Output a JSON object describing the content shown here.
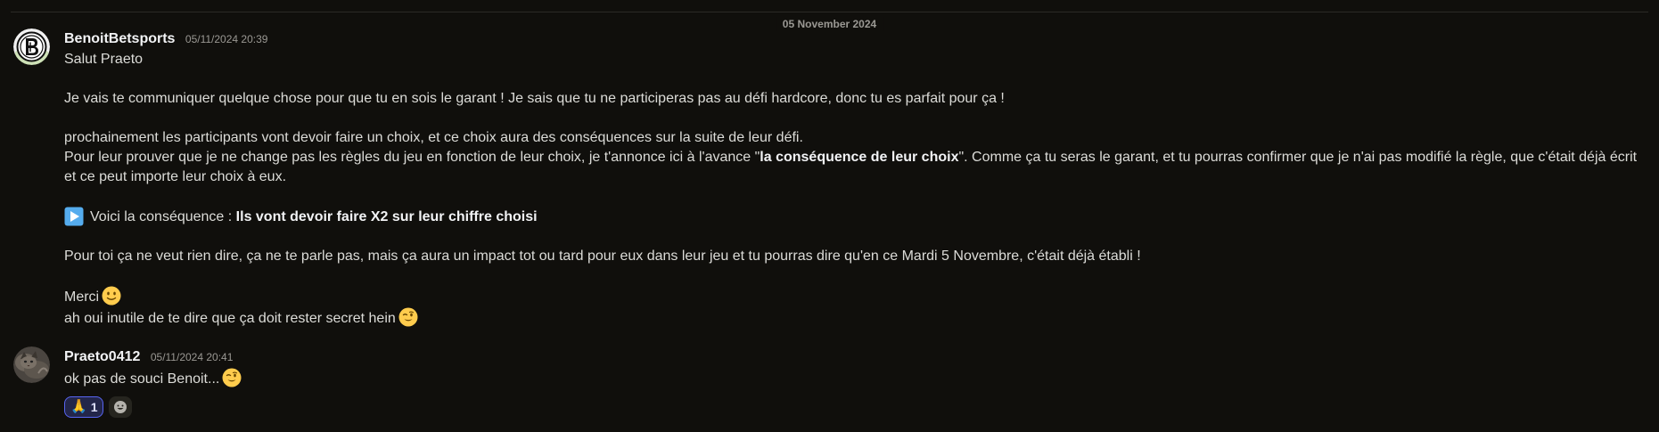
{
  "date_divider": "05 November 2024",
  "messages": [
    {
      "username": "BenoitBetsports",
      "timestamp": "05/11/2024 20:39",
      "avatar_icon": "benoitbetsports-logo-avatar",
      "lines": {
        "l1": "Salut Praeto",
        "l2": "Je vais te communiquer quelque chose pour que tu en sois le garant ! Je sais que tu ne participeras pas au défi hardcore, donc tu es parfait pour ça !",
        "l3": "prochainement les participants vont devoir faire un choix, et ce choix aura des conséquences sur la suite de leur défi.",
        "l4_a": "Pour leur prouver que je ne change pas les règles du jeu en fonction de leur choix, je t'annonce ici à l'avance \"",
        "l4_b": "la conséquence de leur choix",
        "l4_c": "\". Comme ça tu seras le garant, et tu pourras confirmer que je n'ai pas modifié la règle, que c'était déjà écrit et ce peut importe leur choix à eux.",
        "l5_a": "Voici la conséquence : ",
        "l5_b": "Ils vont devoir faire X2 sur leur chiffre choisi",
        "l6": "Pour toi ça ne veut rien dire, ça ne te parle pas, mais ça aura un impact tot ou tard pour eux dans leur jeu et tu pourras dire qu'en ce Mardi 5 Novembre, c'était déjà établi !",
        "l7": "Merci",
        "l8": "ah oui inutile de te dire que ça doit rester secret hein"
      }
    },
    {
      "username": "Praeto0412",
      "timestamp": "05/11/2024 20:41",
      "avatar_icon": "cat-photo-avatar",
      "lines": {
        "l1": "ok pas de souci Benoit..."
      },
      "reactions": [
        {
          "emoji": "🙏",
          "count": "1"
        }
      ]
    }
  ],
  "colors": {
    "background": "#100f0c",
    "text": "#dcdcd8",
    "username": "#f2f3f5",
    "muted": "#9a9893",
    "reaction_border": "#5865f2"
  }
}
